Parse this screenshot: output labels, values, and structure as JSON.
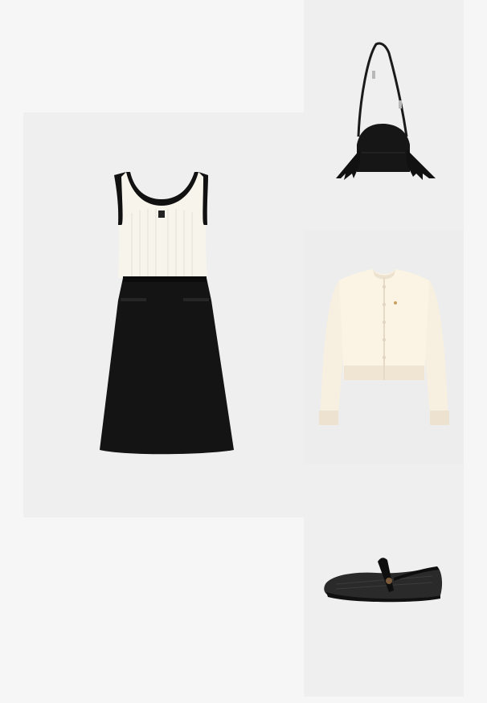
{
  "board": {
    "items": [
      {
        "name": "dress",
        "colors": {
          "top": "#f7f4ec",
          "trim": "#111111",
          "skirt": "#141414"
        }
      },
      {
        "name": "handbag",
        "colors": {
          "body": "#161616",
          "hardware": "#b8b8b8"
        }
      },
      {
        "name": "cardigan",
        "colors": {
          "body": "#fbf3e3",
          "shade": "#ece2cf"
        }
      },
      {
        "name": "flat-shoe",
        "colors": {
          "mesh": "#2a2a2a",
          "strap": "#0e0e0e"
        }
      }
    ]
  }
}
